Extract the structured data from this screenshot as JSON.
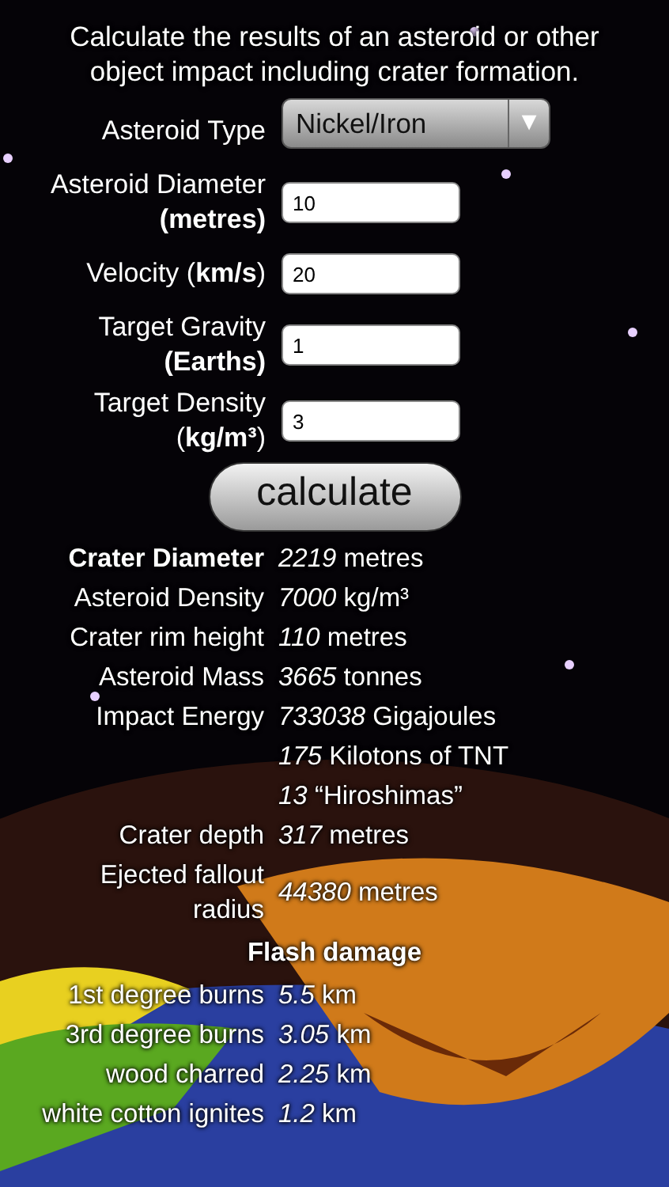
{
  "intro": "Calculate the results of an asteroid or other object impact including crater formation.",
  "inputs": [
    {
      "kind": "select",
      "label": "Asteroid Type",
      "value": "Nickel/Iron",
      "arrow": "▼"
    },
    {
      "kind": "text",
      "label": "Asteroid Diameter **(metres)**",
      "value": "10"
    },
    {
      "kind": "text",
      "label": "Velocity (**km/s**)",
      "value": "20"
    },
    {
      "kind": "text",
      "label": "Target Gravity **(Earths)**",
      "value": "1"
    },
    {
      "kind": "text",
      "label": "Target Density (**kg/m³**)",
      "value": "3"
    }
  ],
  "calculate_button": "calculate",
  "results": [
    {
      "kind": "main",
      "label": "Crater Diameter",
      "value": "*2219* metres"
    },
    {
      "kind": "item",
      "label": "Asteroid Density",
      "value": "*7000* kg/m³"
    },
    {
      "kind": "item",
      "label": "Crater rim height",
      "value": "*110* metres"
    },
    {
      "kind": "item",
      "label": "Asteroid Mass",
      "value": "*3665* tonnes"
    },
    {
      "kind": "item",
      "label": "Impact Energy",
      "value": "*733038* Gigajoules"
    },
    {
      "kind": "item",
      "value": "*175* Kilotons of TNT"
    },
    {
      "kind": "item",
      "value": "*13* “Hiroshimas”"
    },
    {
      "kind": "item",
      "label": "Crater depth",
      "value": "*317* metres"
    },
    {
      "kind": "item",
      "label": "Ejected fallout radius",
      "value": "*44380* metres"
    }
  ],
  "flash_heading": "Flash damage",
  "flash": [
    {
      "label": "1st degree burns",
      "value": "*5.5* km"
    },
    {
      "label": "3rd degree burns",
      "value": "*3.05* km"
    },
    {
      "label": "wood charred",
      "value": "*2.25* km"
    },
    {
      "label": "white cotton ignites",
      "value": "*1.2* km"
    }
  ]
}
